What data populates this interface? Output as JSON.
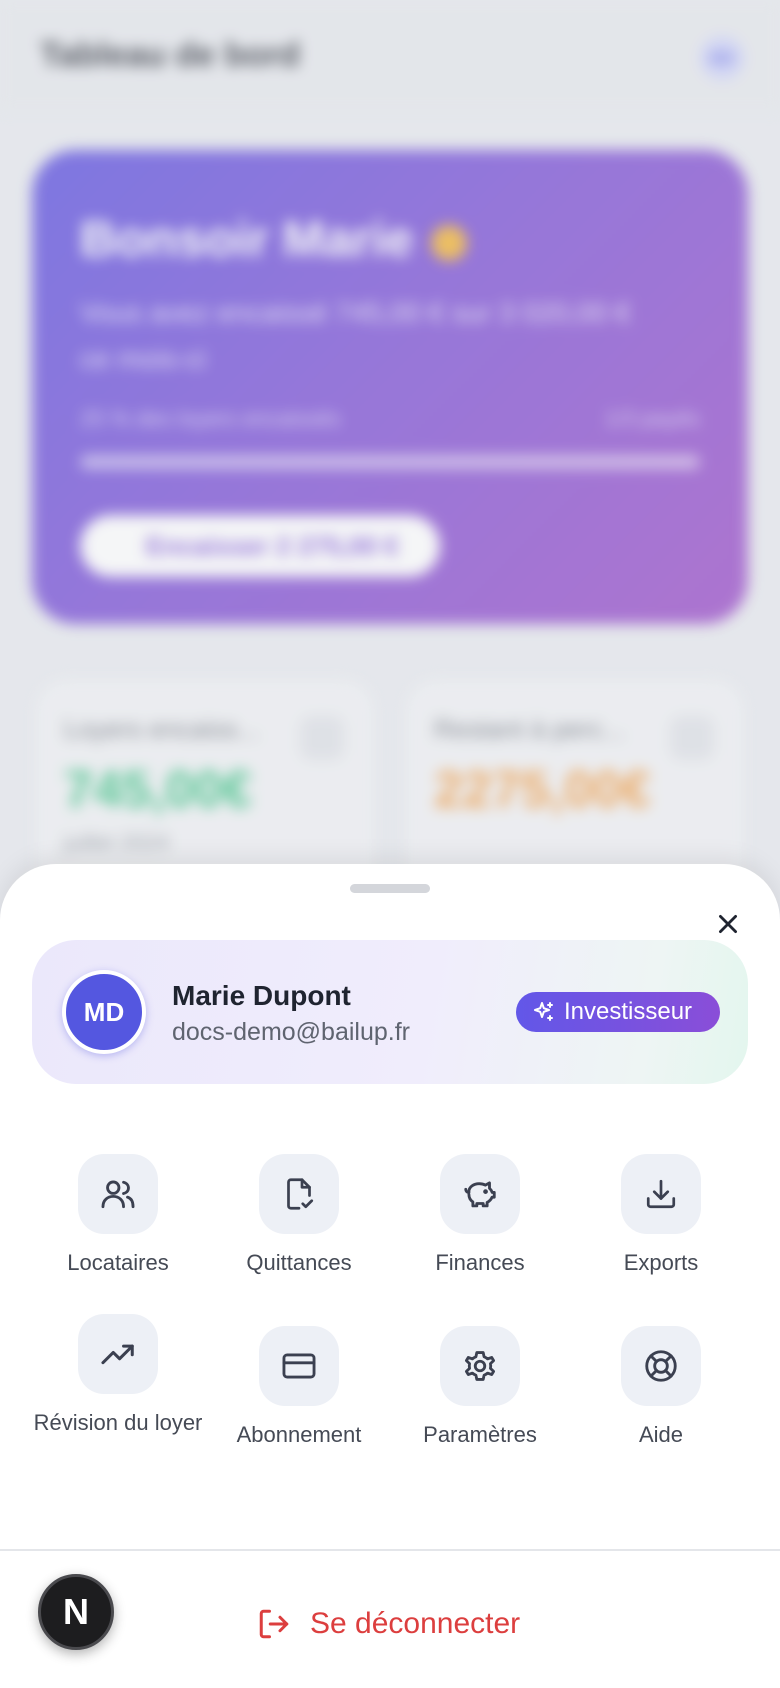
{
  "background": {
    "header_title": "Tableau de bord",
    "header_avatar": "MD",
    "hero": {
      "greeting": "Bonsoir Marie",
      "emoji_icon": "waving-hand-icon",
      "summary_line1": "Vous avez encaissé 745,00 € sur 3 020,00 €",
      "summary_line2": "ce mois-ci",
      "progress_label": "25 % des loyers encaissés",
      "progress_right": "1/3 payés",
      "progress_value": 0.25,
      "button_label": "Encaisser 2 275,00 €"
    },
    "cards": [
      {
        "label": "Loyers encaiss...",
        "value": "745,00€",
        "sub": "juillet 2024"
      },
      {
        "label": "Restant à perc...",
        "value": "2275,00€",
        "sub": ""
      }
    ]
  },
  "sheet": {
    "close_icon": "close-icon",
    "profile": {
      "initials": "MD",
      "name": "Marie Dupont",
      "email": "docs-demo@bailup.fr",
      "badge_label": "Investisseur",
      "badge_icon": "sparkles-icon"
    },
    "menu": [
      {
        "label": "Locataires",
        "icon": "users-icon"
      },
      {
        "label": "Quittances",
        "icon": "file-check-icon"
      },
      {
        "label": "Finances",
        "icon": "piggy-bank-icon"
      },
      {
        "label": "Exports",
        "icon": "download-icon"
      },
      {
        "label": "Révision du loyer",
        "icon": "trending-up-icon"
      },
      {
        "label": "Abonnement",
        "icon": "credit-card-icon"
      },
      {
        "label": "Paramètres",
        "icon": "gear-icon"
      },
      {
        "label": "Aide",
        "icon": "lifebuoy-icon"
      }
    ],
    "logout_label": "Se déconnecter",
    "logout_icon": "logout-icon"
  },
  "overlay_badge": "N",
  "colors": {
    "accent": "#5457e0",
    "badge_gradient_start": "#6257e8",
    "badge_gradient_end": "#8a4ed8",
    "danger": "#dc3e3e",
    "icon_tile_bg": "#edf0f6"
  }
}
